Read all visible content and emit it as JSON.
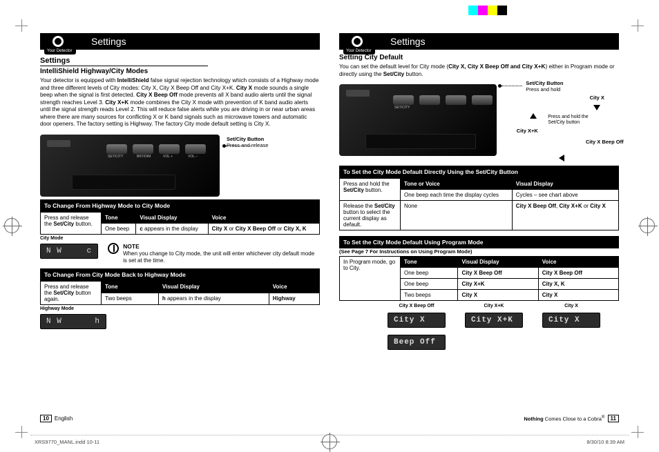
{
  "header": {
    "title_left": "Settings",
    "title_right": "Settings",
    "tab_label": "Your Detector"
  },
  "left": {
    "section_heading": "Settings",
    "subsection_heading": "IntelliShield Highway/City Modes",
    "intro_html": "Your detector is equipped with <b>IntelliShield</b> false signal rejection technology which consists of a Highway mode and three different levels of City modes: City X, City X Beep Off and City X+K. <b>City X</b> mode sounds a single beep when the signal is first detected. <b>City X Beep Off</b> mode prevents all X band audio alerts until the signal strength reaches Level 3. <b>City X+K</b> mode combines the City X mode with prevention of K band audio alerts until the signal strength reads Level 2. This will reduce false alerts while you are driving in or near urban areas where there are many sources for conflicting X or K band signals such as microwave towers and automatic door openers. The factory setting is Highway. The factory City mode default setting is City X.",
    "photo_caption": {
      "title": "Set/City Button",
      "sub": "Press and release"
    },
    "table1": {
      "bar": "To Change From Highway Mode to City Mode",
      "left_cell_html": "Press and release the <b>Set/City</b> button.",
      "cols": [
        "Tone",
        "Visual Display",
        "Voice"
      ],
      "row": [
        "One beep",
        "<b>c</b> appears in the display",
        "<b>City X</b> or <b>City X Beep Off</b> or <b>City X, K</b>"
      ]
    },
    "label_city": "City Mode",
    "lcd_city": {
      "left": "N W",
      "right": "c"
    },
    "note": {
      "title": "NOTE",
      "body": "When you change to City mode, the unit will enter whichever city default mode is set at the time."
    },
    "table2": {
      "bar": "To Change From City Mode Back to Highway Mode",
      "left_cell_html": "Press and release the <b>Set/City</b> button again.",
      "cols": [
        "Tone",
        "Visual Display",
        "Voice"
      ],
      "row": [
        "Two beeps",
        "<b>h</b> appears in the display",
        "<b>Highway</b>"
      ]
    },
    "label_hwy": "Highway Mode",
    "lcd_hwy": {
      "left": "N W",
      "right": "h"
    },
    "page_num": "10",
    "page_lang": "English"
  },
  "right": {
    "sub_heading": "Setting City Default",
    "intro_html": "You can set the default level for City mode (<b>City X, City X Beep Off and City X+K</b>) either in Program mode or directly using the <b>Set/City</b> button.",
    "photo_caption": {
      "title": "Set/City Button",
      "sub": "Press and hold"
    },
    "cycle": {
      "top": "City X",
      "left": "City X+K",
      "right": "City X Beep Off",
      "center_html": "Press and hold the Set/City button"
    },
    "tableA": {
      "bar": "To Set the City Mode Default Directly Using the Set/City Button",
      "cols_left_html": "Press and hold the <b>Set/City</b> button.",
      "cols": [
        "Tone or Voice",
        "Visual Display"
      ],
      "row1": [
        "One beep each time the display cycles",
        "Cycles – see chart above"
      ],
      "left2_html": "Release the <b>Set/City</b> button to select the current display as default.",
      "row2": [
        "None",
        "<b>City X Beep Off</b>, <b>City X+K</b> or <b>City X</b>"
      ]
    },
    "tableB": {
      "bar": "To Set the City Mode Default Using Program Mode",
      "paren": "(See Page 7 For Instructions on Using Program Mode)",
      "left_cell": "In Program mode, go to City.",
      "cols": [
        "Tone",
        "Visual Display",
        "Voice"
      ],
      "rows": [
        [
          "One beep",
          "<b>City X Beep Off</b>",
          "<b>City X Beep Off</b>"
        ],
        [
          "One beep",
          "<b>City X+K</b>",
          "<b>City X, K</b>"
        ],
        [
          "Two beeps",
          "<b>City X</b>",
          "<b>City X</b>"
        ]
      ]
    },
    "lcd_row": {
      "labels": [
        "City X Beep Off",
        "City X+K",
        "City X"
      ],
      "displays": [
        [
          "City X",
          "Beep Off"
        ],
        [
          "City X+K"
        ],
        [
          "City X"
        ]
      ]
    },
    "page_num": "11",
    "tagline_html": "<b>Nothing</b> Comes Close to a Cobra<sup>®</sup>"
  },
  "footer": {
    "file": "XRS9770_MANL.indd   10-11",
    "date": "8/30/10   8:39 AM"
  }
}
